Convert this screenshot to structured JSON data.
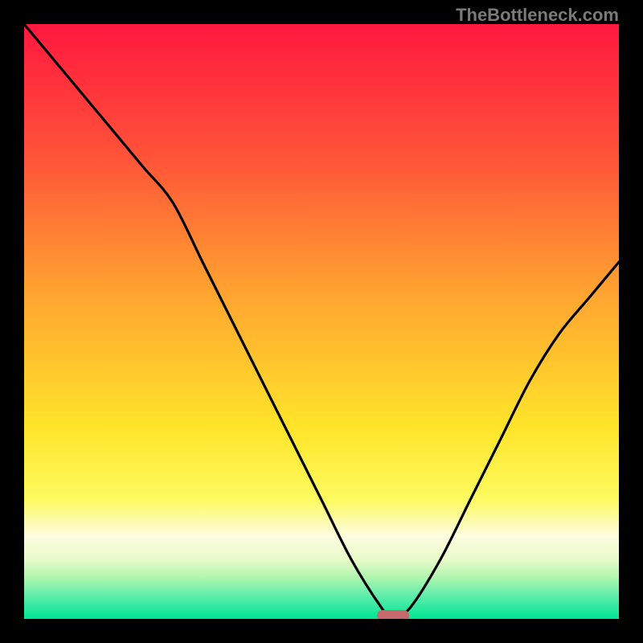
{
  "watermark": "TheBottleneck.com",
  "colors": {
    "frame": "#000000",
    "curve": "#000000",
    "marker": "#c6696c",
    "gradient_stops": [
      {
        "pct": 0,
        "color": "#ff183f"
      },
      {
        "pct": 22,
        "color": "#ff5238"
      },
      {
        "pct": 45,
        "color": "#ffa330"
      },
      {
        "pct": 68,
        "color": "#ffe52a"
      },
      {
        "pct": 80,
        "color": "#fdfb60"
      },
      {
        "pct": 86,
        "color": "#fdfce0"
      },
      {
        "pct": 90,
        "color": "#e8fbca"
      },
      {
        "pct": 93,
        "color": "#b0f6af"
      },
      {
        "pct": 96,
        "color": "#62edab"
      },
      {
        "pct": 100,
        "color": "#00e595"
      }
    ]
  },
  "chart_data": {
    "type": "line",
    "title": "",
    "xlabel": "",
    "ylabel": "",
    "xlim": [
      0,
      100
    ],
    "ylim": [
      0,
      100
    ],
    "series": [
      {
        "name": "bottleneck-curve",
        "x": [
          0,
          5,
          10,
          15,
          20,
          25,
          30,
          35,
          40,
          45,
          50,
          55,
          60,
          62,
          65,
          70,
          75,
          80,
          85,
          90,
          95,
          100
        ],
        "values": [
          100,
          94,
          88,
          82,
          76,
          70,
          60,
          50,
          40,
          30,
          20,
          10,
          2,
          0,
          2,
          10,
          20,
          30,
          40,
          48,
          54,
          60
        ]
      }
    ],
    "optimal_x": 62,
    "optimal_y": 0
  }
}
